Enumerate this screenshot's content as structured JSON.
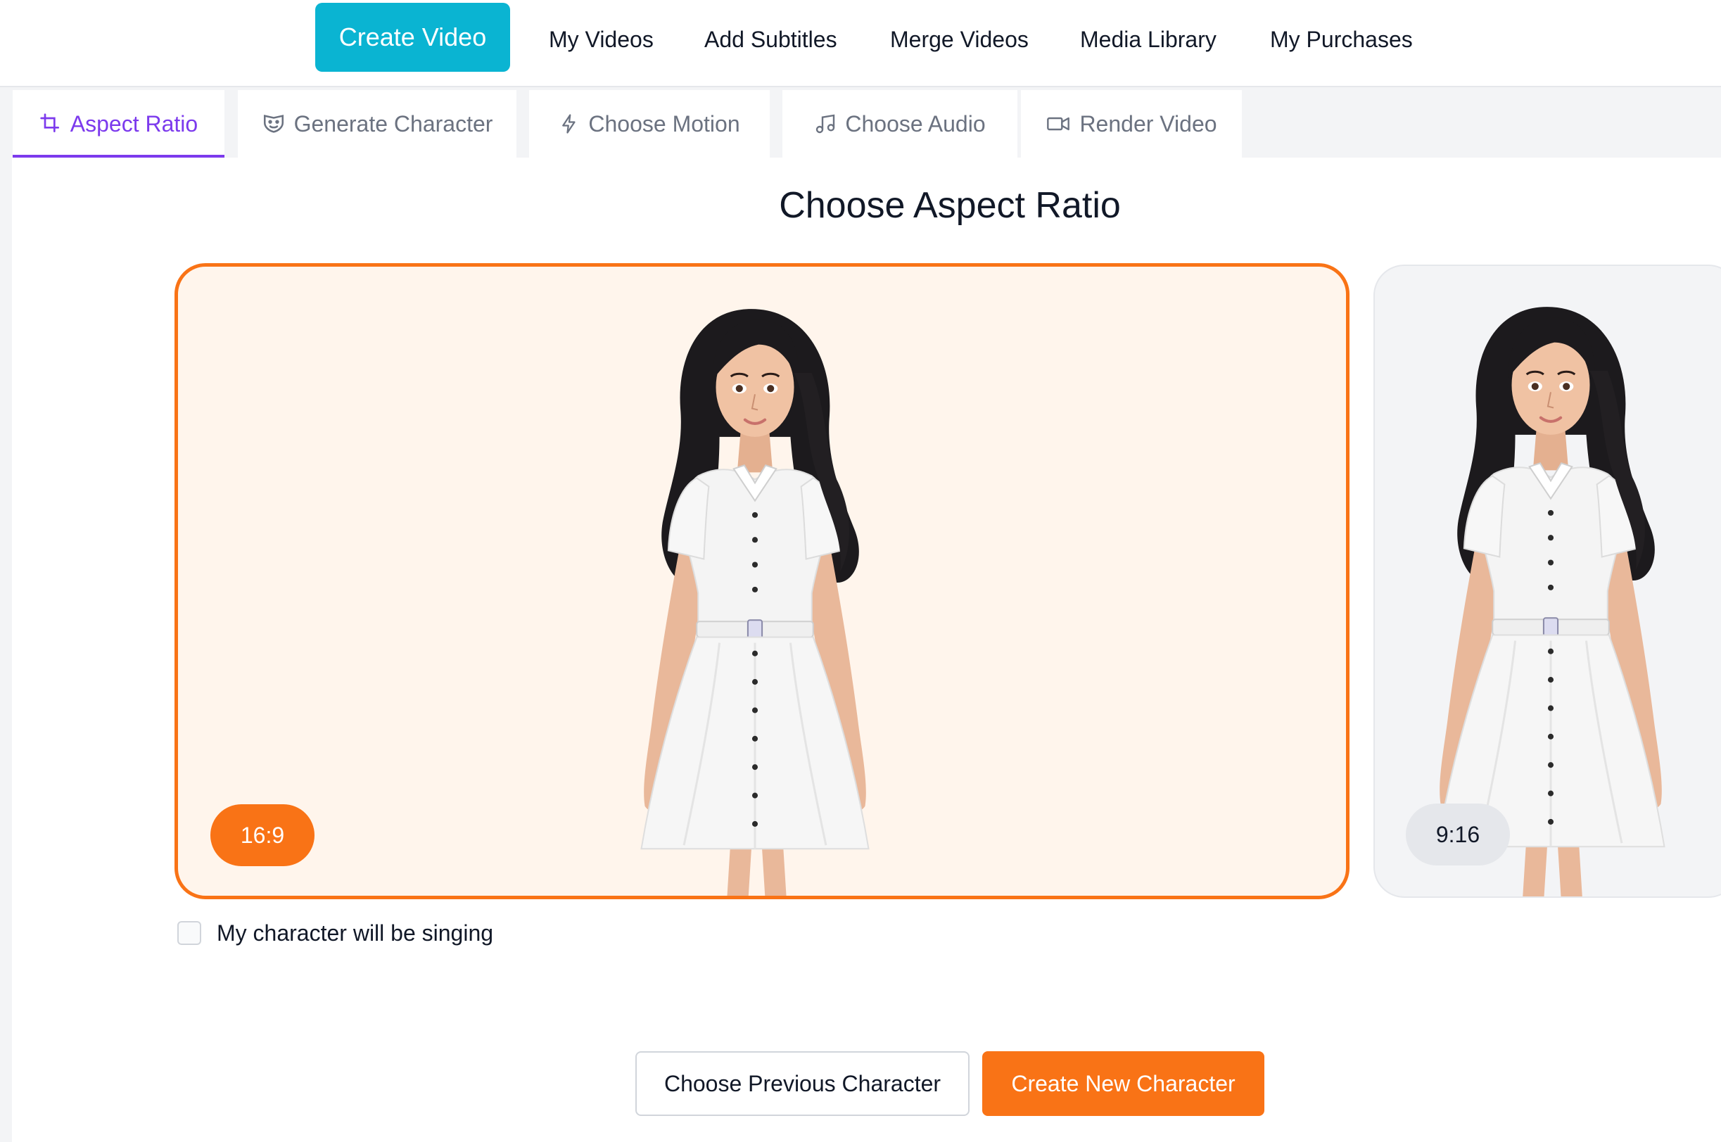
{
  "topnav": {
    "primary": "Create Video",
    "links": [
      "My Videos",
      "Add Subtitles",
      "Merge Videos",
      "Media Library",
      "My Purchases"
    ]
  },
  "tabs": [
    {
      "label": "Aspect Ratio",
      "icon": "crop-icon",
      "active": true
    },
    {
      "label": "Generate Character",
      "icon": "theater-masks-icon",
      "active": false
    },
    {
      "label": "Choose Motion",
      "icon": "lightning-icon",
      "active": false
    },
    {
      "label": "Choose Audio",
      "icon": "music-note-icon",
      "active": false
    },
    {
      "label": "Render Video",
      "icon": "video-camera-icon",
      "active": false
    }
  ],
  "main": {
    "title": "Choose Aspect Ratio",
    "options": [
      {
        "ratio": "16:9",
        "selected": true
      },
      {
        "ratio": "9:16",
        "selected": false
      }
    ],
    "singing_checkbox": {
      "label": "My character will be singing",
      "checked": false
    }
  },
  "actions": {
    "previous": "Choose Previous Character",
    "create": "Create New Character"
  },
  "colors": {
    "accent_cyan": "#0ab4d2",
    "accent_orange": "#f97316",
    "active_tab": "#7c3aed"
  }
}
